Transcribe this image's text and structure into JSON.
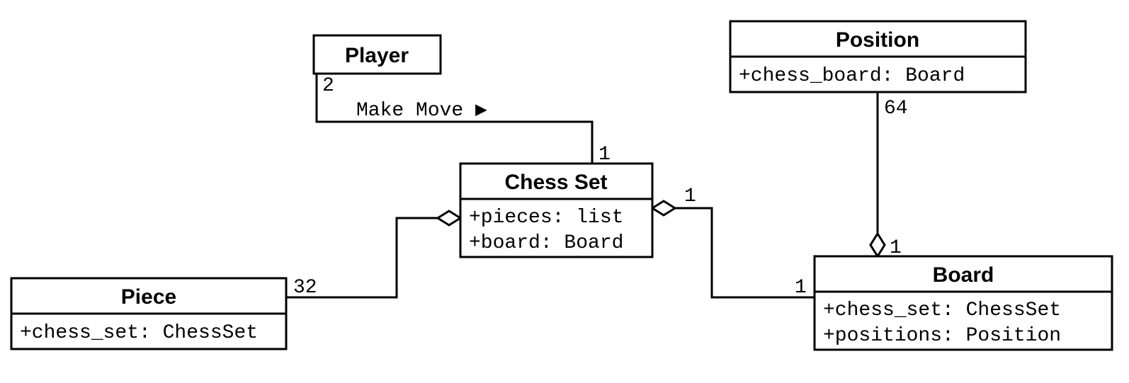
{
  "classes": {
    "player": {
      "name": "Player",
      "attrs": []
    },
    "chessset": {
      "name": "Chess Set",
      "attrs": [
        "+pieces: list",
        "+board: Board"
      ]
    },
    "piece": {
      "name": "Piece",
      "attrs": [
        "+chess_set: ChessSet"
      ]
    },
    "position": {
      "name": "Position",
      "attrs": [
        "+chess_board: Board"
      ]
    },
    "board": {
      "name": "Board",
      "attrs": [
        "+chess_set: ChessSet",
        "+positions: Position"
      ]
    }
  },
  "relations": {
    "player_chessset": {
      "label": "Make Move",
      "mult_player": "2",
      "mult_chessset": "1"
    },
    "piece_chessset": {
      "mult_piece": "32"
    },
    "chessset_board": {
      "mult_chessset": "1",
      "mult_board": "1"
    },
    "position_board": {
      "mult_position": "64",
      "mult_board": "1"
    }
  }
}
